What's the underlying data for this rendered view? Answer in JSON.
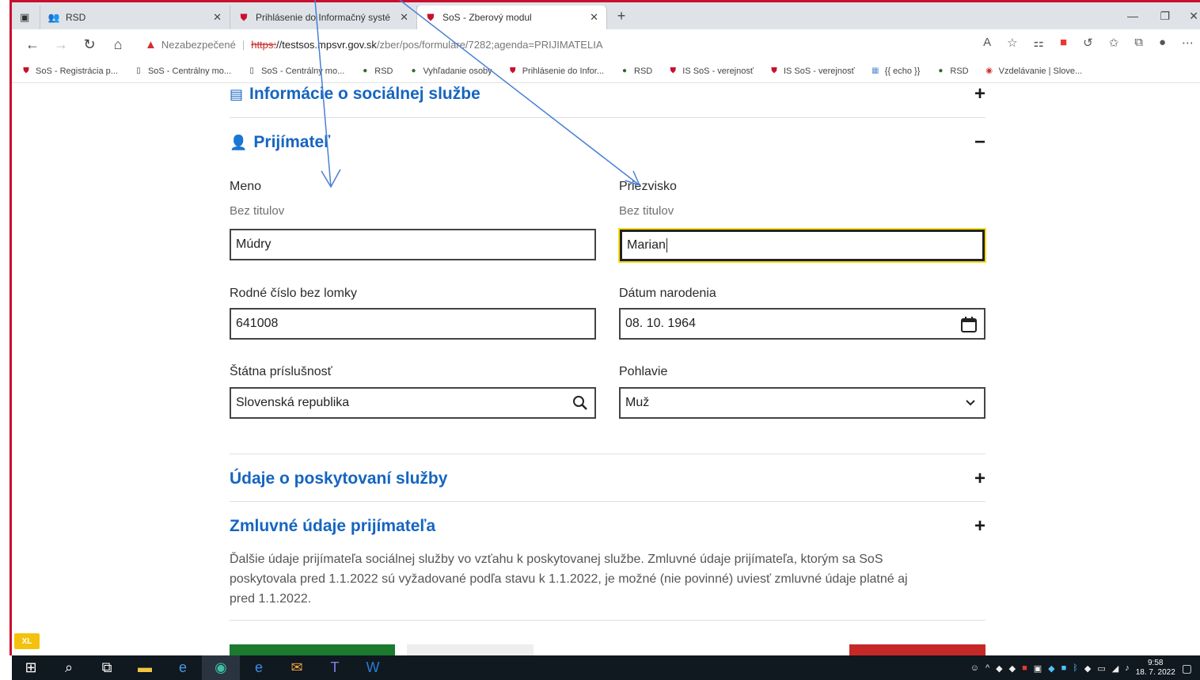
{
  "browser": {
    "tabs": [
      {
        "label": "RSD",
        "icon": "people-icon",
        "active": false
      },
      {
        "label": "Prihlásenie do Informačný systé",
        "icon": "shield-icon",
        "active": false
      },
      {
        "label": "SoS - Zberový modul",
        "icon": "shield-icon",
        "active": true
      }
    ],
    "security_label": "Nezabezpečené",
    "url_scheme": "https:",
    "url_host": "//testsos.mpsvr.gov.sk",
    "url_path": "/zber/pos/formulare/7282;agenda=PRIJIMATELIA",
    "bookmarks": [
      {
        "label": "SoS - Registrácia p...",
        "icon": "shield"
      },
      {
        "label": "SoS - Centrálny mo...",
        "icon": "page"
      },
      {
        "label": "SoS - Centrálny mo...",
        "icon": "page"
      },
      {
        "label": "RSD",
        "icon": "people"
      },
      {
        "label": "Vyhľadanie osoby",
        "icon": "people"
      },
      {
        "label": "Prihlásenie do Infor...",
        "icon": "shield"
      },
      {
        "label": "RSD",
        "icon": "people"
      },
      {
        "label": "IS SoS - verejnosť",
        "icon": "shield"
      },
      {
        "label": "IS SoS - verejnosť",
        "icon": "shield"
      },
      {
        "label": "{{ echo }}",
        "icon": "grid"
      },
      {
        "label": "RSD",
        "icon": "people"
      },
      {
        "label": "Vzdelávanie | Slove...",
        "icon": "red-circle"
      }
    ]
  },
  "form": {
    "section_info": {
      "title": "Informácie o sociálnej službe",
      "toggle": "+"
    },
    "section_recipient": {
      "title": "Prijímateľ",
      "toggle": "−"
    },
    "first_name": {
      "label": "Meno",
      "hint": "Bez titulov",
      "value": "Múdry"
    },
    "last_name": {
      "label": "Priezvisko",
      "hint": "Bez titulov",
      "value": "Marian"
    },
    "birth_number": {
      "label": "Rodné číslo bez lomky",
      "value": "641008"
    },
    "birth_date": {
      "label": "Dátum narodenia",
      "value": "08. 10. 1964"
    },
    "nationality": {
      "label": "Štátna príslušnosť",
      "value": "Slovenská republika"
    },
    "gender": {
      "label": "Pohlavie",
      "value": "Muž"
    },
    "section_service": {
      "title": "Údaje o poskytovaní služby",
      "toggle": "+"
    },
    "section_contract": {
      "title": "Zmluvné údaje prijímateľa",
      "toggle": "+"
    },
    "contract_text_1": "Ďalšie údaje prijímateľa sociálnej služby vo vzťahu k poskytovanej službe. Zmluvné údaje prijímateľa, ktorým sa SoS",
    "contract_text_2": "poskytovala pred 1.1.2022 sú vyžadované podľa stavu k 1.1.2022, je možné (nie povinné) uviesť zmluvné údaje platné aj",
    "contract_text_3": "pred 1.1.2022."
  },
  "taskbar": {
    "time": "9:58",
    "date": "18. 7. 2022"
  },
  "colors": {
    "accent": "#1565c0",
    "frame_red": "#c8102e",
    "focus_yellow": "#f7dc1a",
    "arrow_blue": "#4a7fd4"
  }
}
